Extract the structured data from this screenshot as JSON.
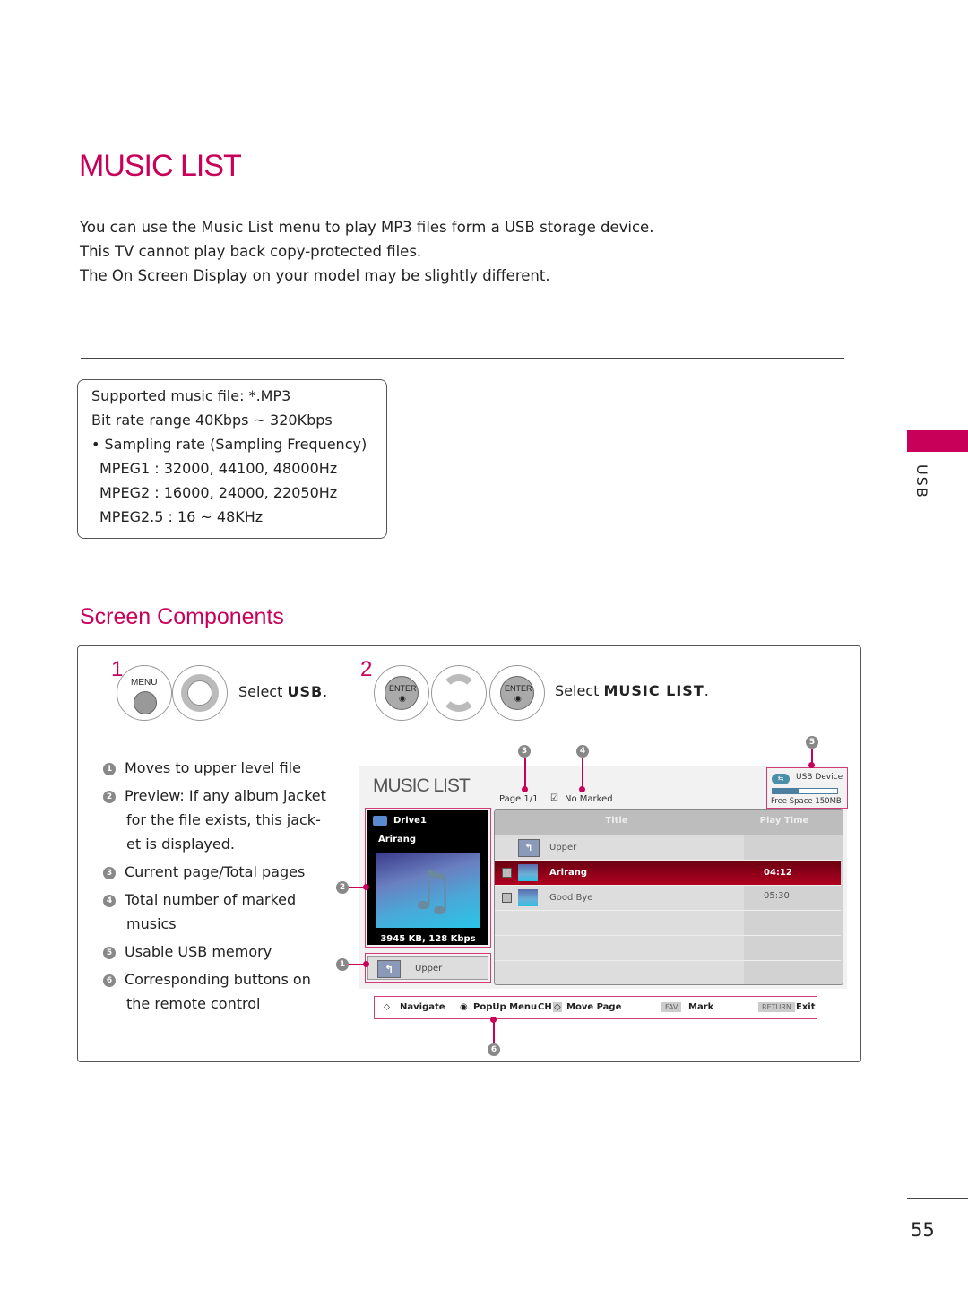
{
  "page": {
    "title": "MUSIC LIST",
    "intro": [
      "You can use the Music List menu to play MP3 files form a USB storage device.",
      "This TV cannot play back copy-protected files.",
      "The On Screen Display on your model may be slightly different."
    ],
    "side_tab": "USB",
    "page_number": "55",
    "accent_color": "#c8005a"
  },
  "spec_box": {
    "heading": "Supported music file: *.MP3",
    "lines": [
      "Bit rate range 40Kbps ~ 320Kbps",
      "• Sampling rate (Sampling Frequency)",
      "MPEG1 : 32000, 44100, 48000Hz",
      "MPEG2 : 16000, 24000, 22050Hz",
      "MPEG2.5 : 16 ~ 48KHz"
    ]
  },
  "screen_components": {
    "heading": "Screen Components",
    "step1": {
      "number": "1",
      "button_label": "MENU",
      "instruction_prefix": "Select ",
      "instruction_bold": "USB",
      "instruction_suffix": "."
    },
    "step2": {
      "number": "2",
      "button_label": "ENTER",
      "instruction_prefix": "Select ",
      "instruction_bold": "MUSIC LIST",
      "instruction_suffix": "."
    },
    "descriptions": [
      {
        "num": "1",
        "lines": [
          "Moves to upper level file"
        ]
      },
      {
        "num": "2",
        "lines": [
          "Preview: If any album jacket",
          "for the file exists, this jack-",
          "et is displayed."
        ]
      },
      {
        "num": "3",
        "lines": [
          "Current page/Total pages"
        ]
      },
      {
        "num": "4",
        "lines": [
          "Total number of marked",
          "musics"
        ]
      },
      {
        "num": "5",
        "lines": [
          "Usable USB memory"
        ]
      },
      {
        "num": "6",
        "lines": [
          "Corresponding buttons on",
          "the remote control"
        ]
      }
    ]
  },
  "osd": {
    "title": "MUSIC LIST",
    "page_info": "Page 1/1",
    "marked_info": "No Marked",
    "usb_device": {
      "label": "USB Device",
      "free_space": "Free Space 150MB",
      "used_fraction": 0.4
    },
    "preview": {
      "drive": "Drive1",
      "track": "Arirang",
      "file_info": "3945 KB, 128 Kbps"
    },
    "upper_button": "Upper",
    "columns": [
      "Title",
      "Play Time"
    ],
    "rows": [
      {
        "type": "folder",
        "title": "Upper",
        "time": "",
        "selected": false
      },
      {
        "type": "music",
        "title": "Arirang",
        "time": "04:12",
        "selected": true
      },
      {
        "type": "music",
        "title": "Good Bye",
        "time": "05:30",
        "selected": false
      }
    ],
    "footer": {
      "navigate": "Navigate",
      "popup": "PopUp Menu",
      "ch_label": "CH",
      "move_page": "Move Page",
      "fav_key": "FAV",
      "mark": "Mark",
      "return_key": "RETURN",
      "exit": "Exit"
    },
    "callouts": [
      "1",
      "2",
      "3",
      "4",
      "5",
      "6"
    ]
  }
}
